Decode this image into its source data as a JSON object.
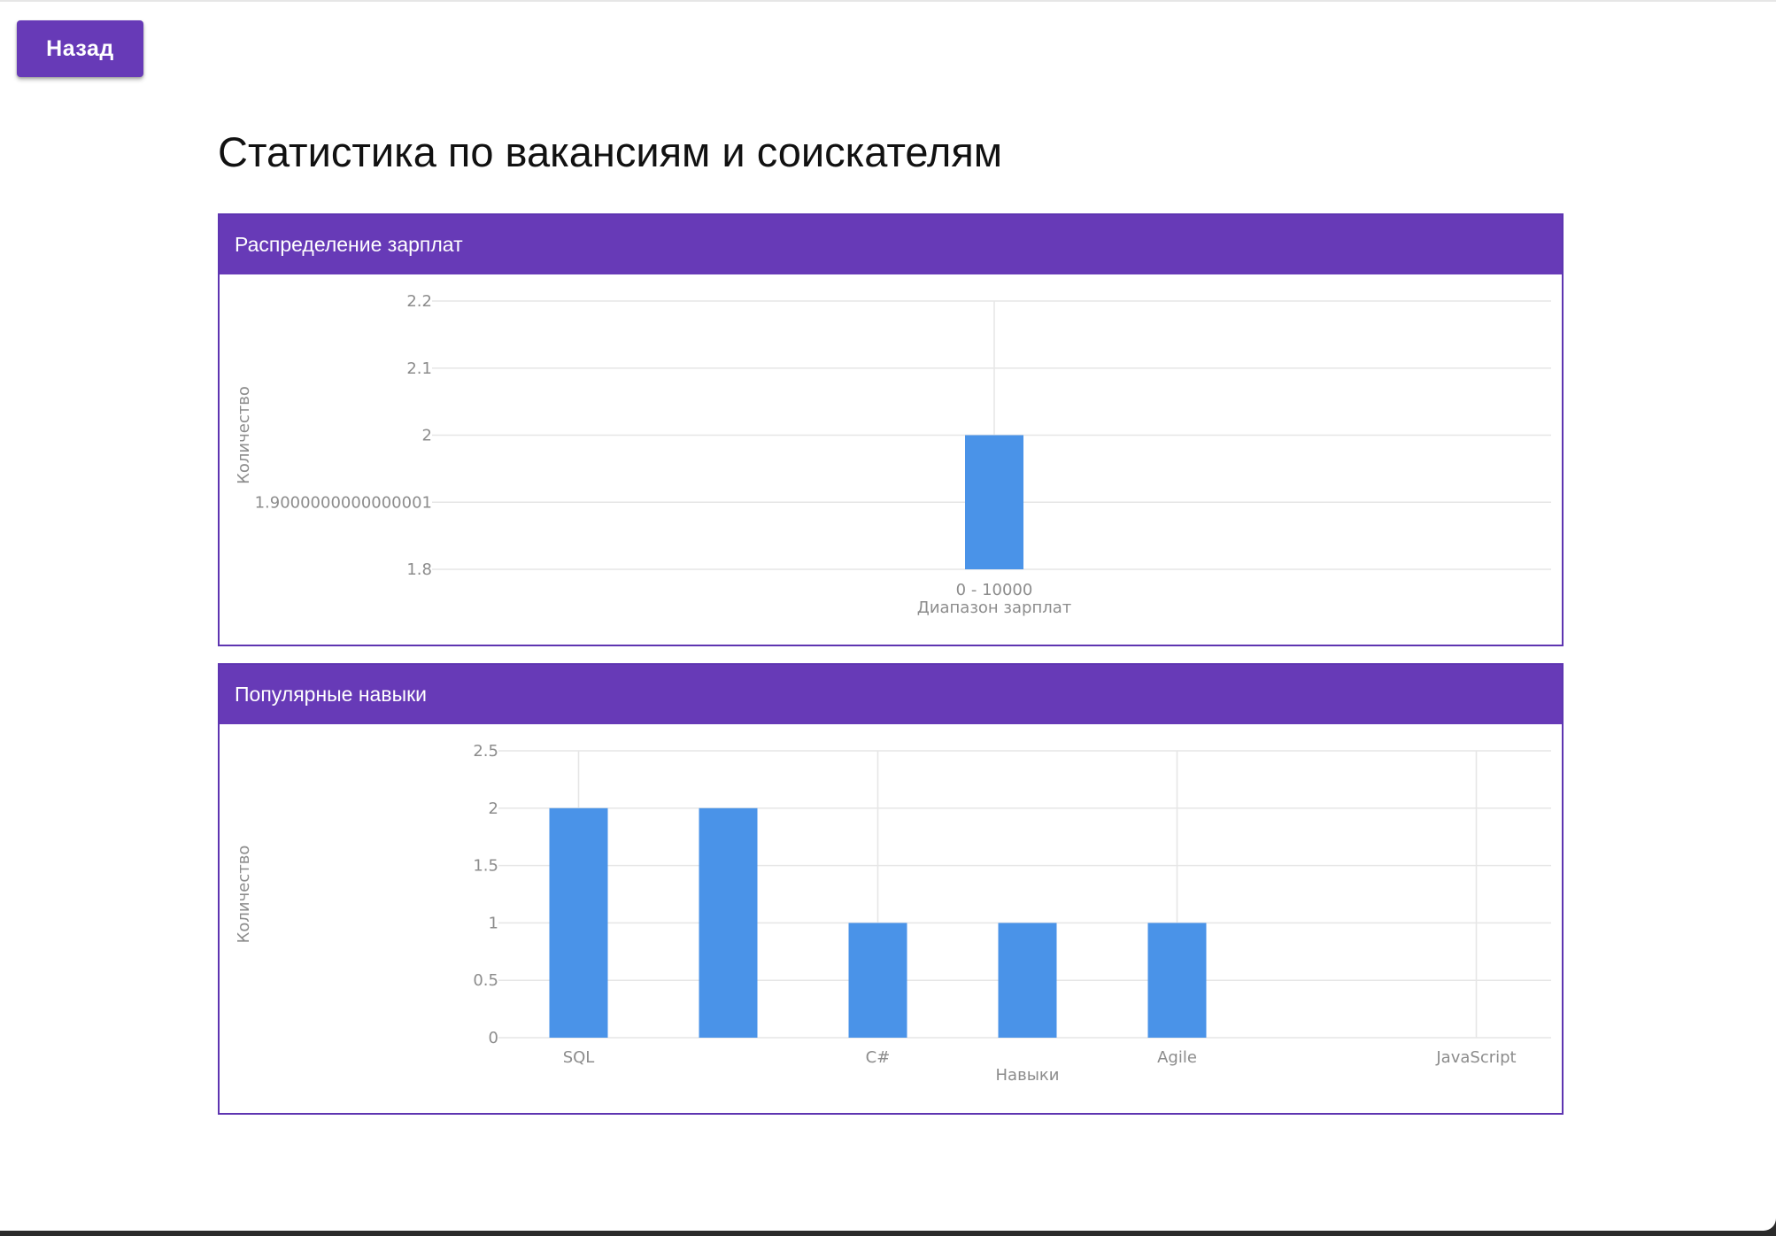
{
  "header": {
    "back_label": "Назад",
    "title": "Статистика по вакансиям и соискателям"
  },
  "colors": {
    "accent": "#673ab7",
    "bar": "#4a93e8",
    "grid": "#e6e6e6",
    "axis_text": "#8c8c8c"
  },
  "cards": {
    "salary": {
      "title": "Распределение зарплат"
    },
    "skills": {
      "title": "Популярные навыки"
    }
  },
  "chart_data": [
    {
      "id": "salary",
      "type": "bar",
      "title": "Распределение зарплат",
      "xlabel": "Диапазон зарплат",
      "ylabel": "Количество",
      "categories": [
        "0 - 10000"
      ],
      "values": [
        2
      ],
      "ylim": [
        1.8,
        2.2
      ],
      "yticks": [
        1.8,
        1.9000000000000001,
        2,
        2.1,
        2.2
      ],
      "ytick_labels": [
        "1.8",
        "1.9000000000000001",
        "2",
        "2.1",
        "2.2"
      ],
      "grid": true
    },
    {
      "id": "skills",
      "type": "bar",
      "title": "Популярные навыки",
      "xlabel": "Навыки",
      "ylabel": "Количество",
      "categories": [
        "SQL",
        "",
        "C#",
        "",
        "Agile",
        "",
        "JavaScript"
      ],
      "values": [
        2,
        2,
        1,
        1,
        1,
        0,
        0
      ],
      "ylim": [
        0,
        2.5
      ],
      "yticks": [
        0,
        0.5,
        1,
        1.5,
        2,
        2.5
      ],
      "ytick_labels": [
        "0",
        "0.5",
        "1",
        "1.5",
        "2",
        "2.5"
      ],
      "grid": true
    }
  ]
}
